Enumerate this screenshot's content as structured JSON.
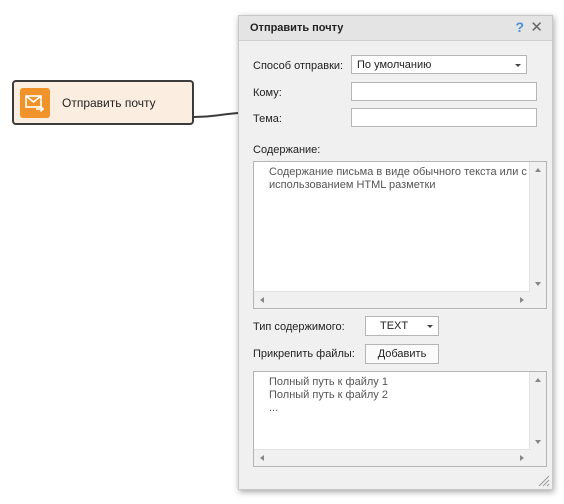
{
  "node": {
    "label": "Отправить почту",
    "icon": "mail-send-icon",
    "accent": "#f0932b"
  },
  "dialog": {
    "title": "Отправить почту",
    "help_label": "?",
    "close_label": "✕",
    "fields": {
      "send_method_label": "Способ отправки:",
      "send_method_value": "По умолчанию",
      "to_label": "Кому:",
      "subject_label": "Тема:",
      "content_label": "Содержание:",
      "content_placeholder": "Содержание письма в виде обычного текста или с\nиспользованием HTML разметки",
      "content_type_label": "Тип содержимого:",
      "content_type_value": "TEXT",
      "attach_label": "Прикрепить файлы:",
      "add_button": "Добавить",
      "files_placeholder": "Полный путь к файлу 1\nПолный путь к файлу 2\n..."
    }
  }
}
